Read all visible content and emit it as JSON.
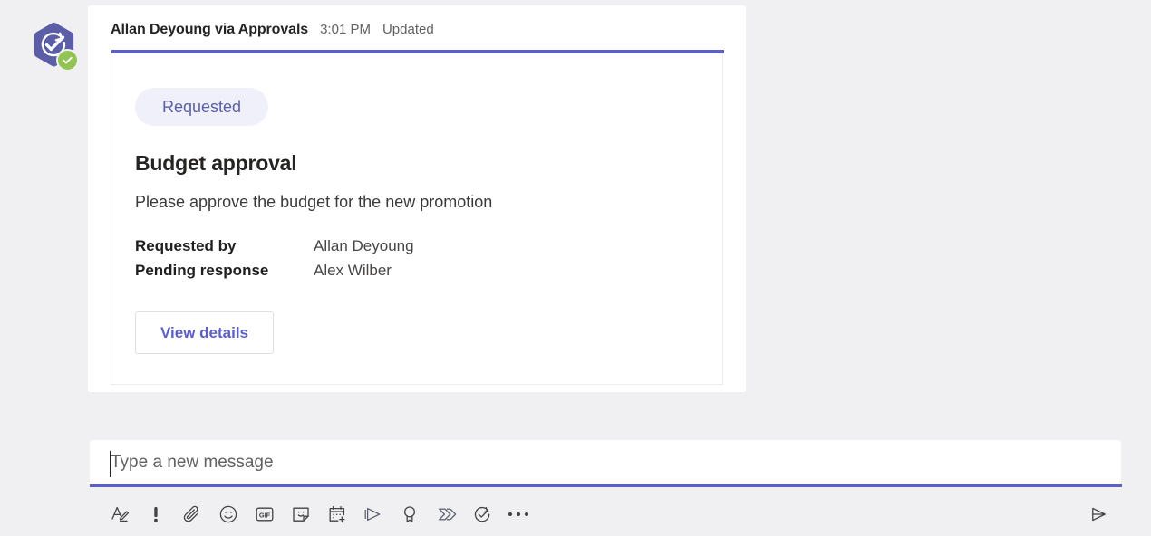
{
  "theme": {
    "page_background": "#f0eff1",
    "accent_purple": "#5b5fc7",
    "badge_background": "#f0f0fa",
    "badge_text": "#5c5fa5",
    "presence_green": "#92c353",
    "card_surface": "#ffffff"
  },
  "message": {
    "avatar_icon": "approvals-app-icon",
    "avatar_badge_icon": "check-badge-icon",
    "sender": "Allan Deyoung via Approvals",
    "time": "3:01 PM",
    "status": "Updated"
  },
  "card": {
    "status_badge": "Requested",
    "title": "Budget approval",
    "description": "Please approve the budget for the new promotion",
    "facts": [
      {
        "label": "Requested by",
        "value": "Allan Deyoung"
      },
      {
        "label": "Pending response",
        "value": "Alex Wilber"
      }
    ],
    "action_label": "View details"
  },
  "compose": {
    "placeholder": "Type a new message",
    "value": "",
    "toolbar": [
      {
        "name": "format-icon",
        "label": "Format"
      },
      {
        "name": "importance-icon",
        "label": "Set delivery options"
      },
      {
        "name": "attach-icon",
        "label": "Attach"
      },
      {
        "name": "emoji-icon",
        "label": "Emoji"
      },
      {
        "name": "giphy-icon",
        "label": "GIF"
      },
      {
        "name": "sticker-icon",
        "label": "Sticker"
      },
      {
        "name": "schedule-meeting-icon",
        "label": "Schedule a meeting"
      },
      {
        "name": "stream-icon",
        "label": "Stream"
      },
      {
        "name": "praise-icon",
        "label": "Praise"
      },
      {
        "name": "power-automate-icon",
        "label": "Power Automate"
      },
      {
        "name": "approvals-icon",
        "label": "Approvals"
      },
      {
        "name": "more-options-icon",
        "label": "More options"
      }
    ],
    "send_label": "Send",
    "gif_badge_text": "GIF"
  }
}
